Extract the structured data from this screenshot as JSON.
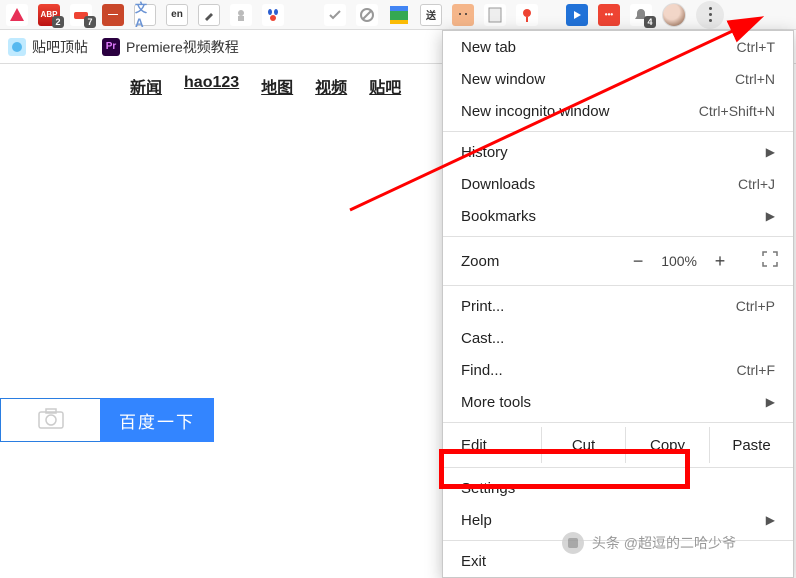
{
  "ext_bar": {
    "badges": {
      "abp": "2",
      "key": "7",
      "bell": "4"
    }
  },
  "bookmarks": {
    "item1": "贴吧顶帖",
    "item2": "Premiere视频教程"
  },
  "nav": {
    "news": "新闻",
    "hao123": "hao123",
    "map": "地图",
    "video": "视频",
    "tieba": "贴吧"
  },
  "search": {
    "button": "百度一下"
  },
  "menu": {
    "new_tab": {
      "label": "New tab",
      "shortcut": "Ctrl+T"
    },
    "new_window": {
      "label": "New window",
      "shortcut": "Ctrl+N"
    },
    "incognito": {
      "label": "New incognito window",
      "shortcut": "Ctrl+Shift+N"
    },
    "history": "History",
    "downloads": {
      "label": "Downloads",
      "shortcut": "Ctrl+J"
    },
    "bookmarks": "Bookmarks",
    "zoom": {
      "label": "Zoom",
      "minus": "−",
      "value": "100%",
      "plus": "+"
    },
    "print": {
      "label": "Print...",
      "shortcut": "Ctrl+P"
    },
    "cast": "Cast...",
    "find": {
      "label": "Find...",
      "shortcut": "Ctrl+F"
    },
    "more_tools": "More tools",
    "edit": {
      "label": "Edit",
      "cut": "Cut",
      "copy": "Copy",
      "paste": "Paste"
    },
    "settings": "Settings",
    "help": "Help",
    "exit": "Exit"
  },
  "watermark": "头条 @超逗的二哈少爷"
}
